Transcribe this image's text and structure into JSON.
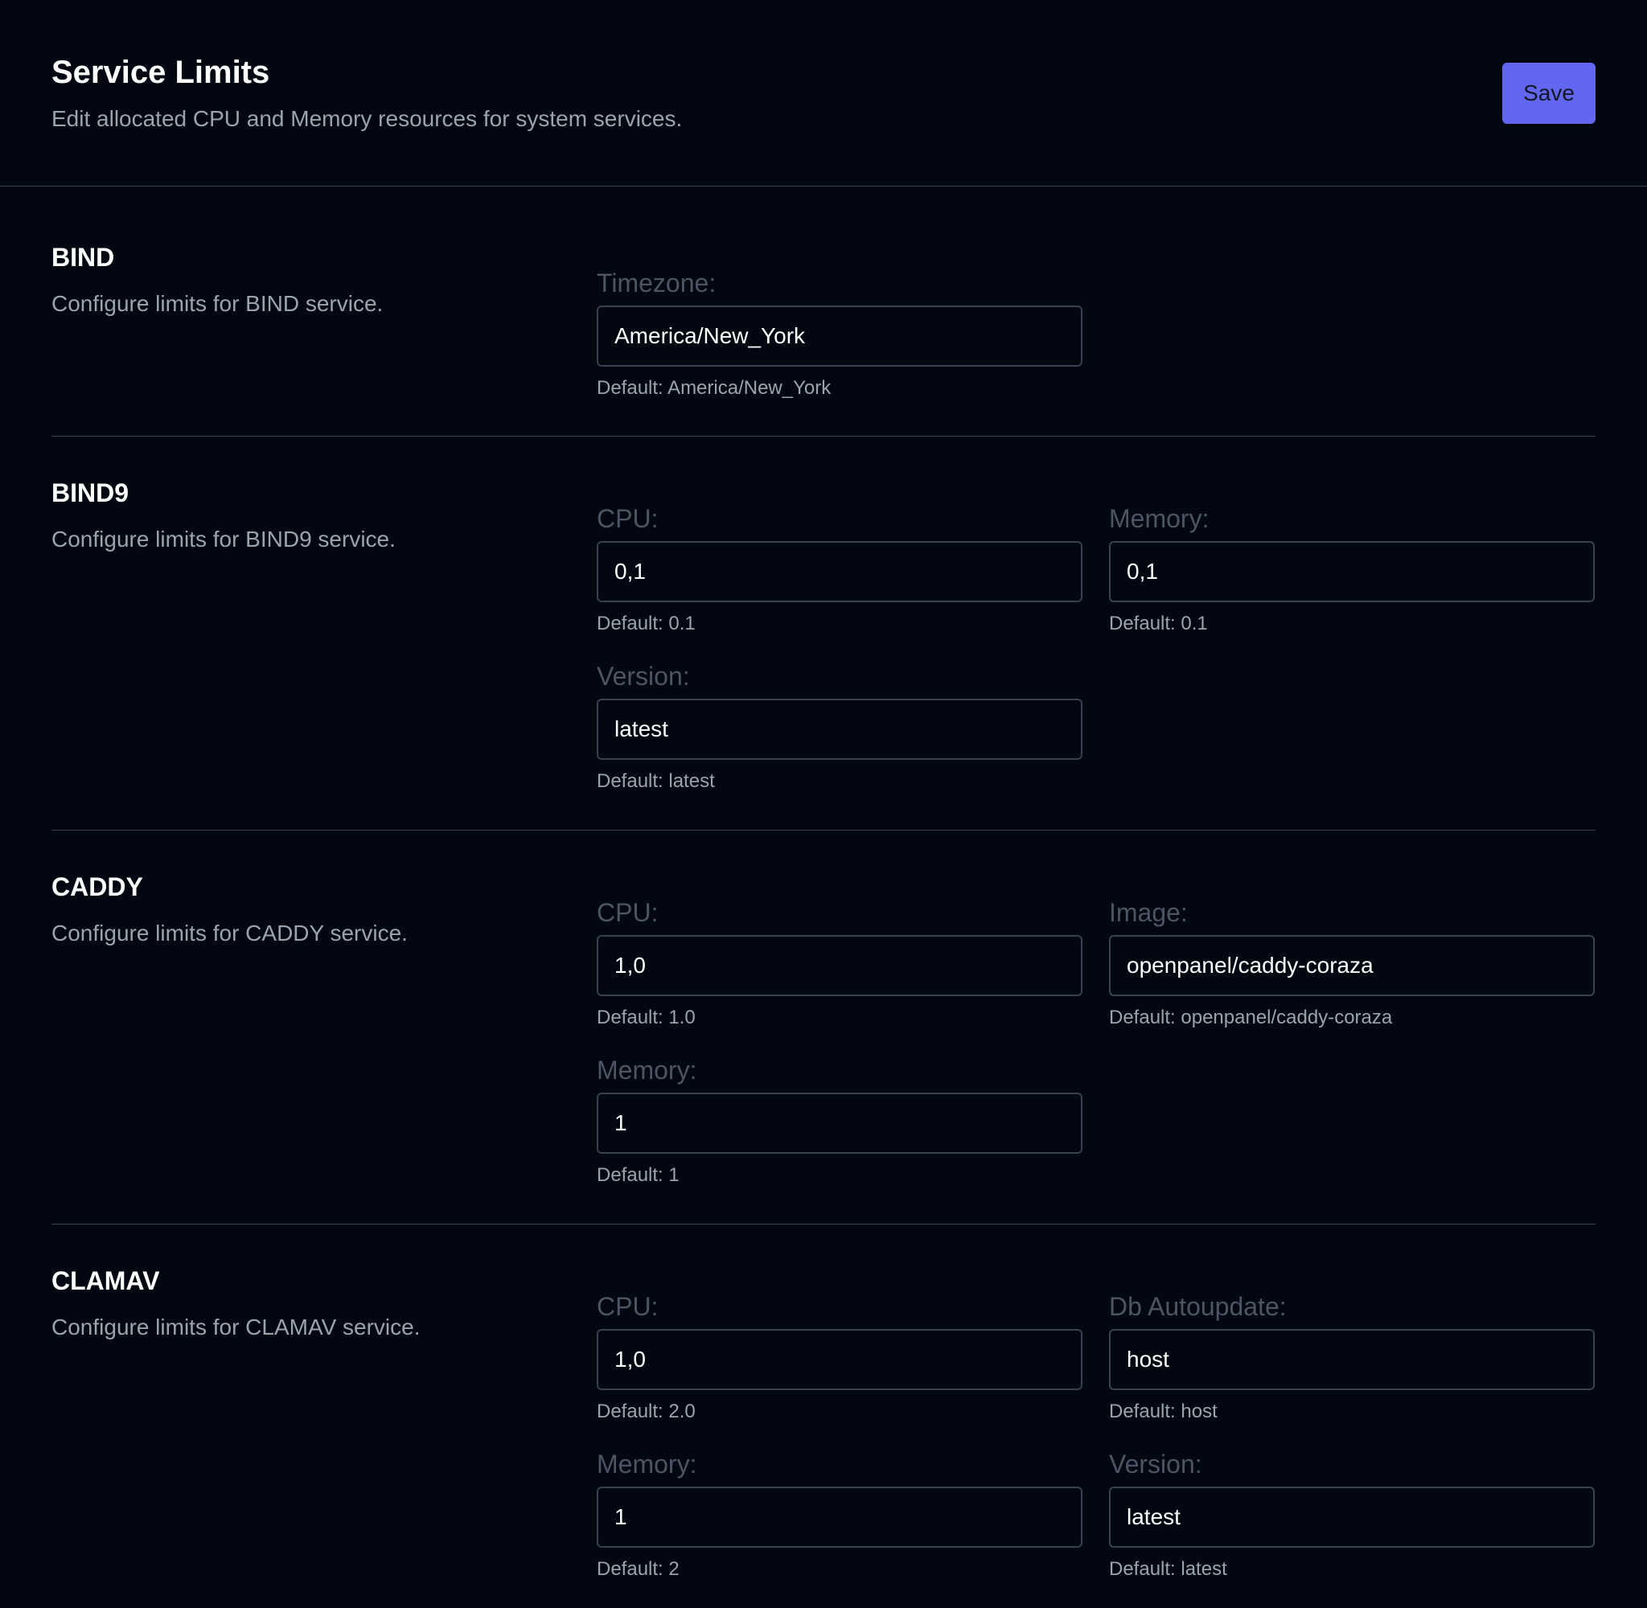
{
  "header": {
    "title": "Service Limits",
    "subtitle": "Edit allocated CPU and Memory resources for system services.",
    "save_label": "Save"
  },
  "sections": [
    {
      "title": "BIND",
      "description": "Configure limits for BIND service.",
      "fields": [
        {
          "label": "Timezone:",
          "value": "America/New_York",
          "hint": "Default: America/New_York"
        }
      ]
    },
    {
      "title": "BIND9",
      "description": "Configure limits for BIND9 service.",
      "fields": [
        {
          "label": "CPU:",
          "value": "0,1",
          "hint": "Default: 0.1"
        },
        {
          "label": "Memory:",
          "value": "0,1",
          "hint": "Default: 0.1"
        },
        {
          "label": "Version:",
          "value": "latest",
          "hint": "Default: latest"
        }
      ]
    },
    {
      "title": "CADDY",
      "description": "Configure limits for CADDY service.",
      "fields": [
        {
          "label": "CPU:",
          "value": "1,0",
          "hint": "Default: 1.0"
        },
        {
          "label": "Image:",
          "value": "openpanel/caddy-coraza",
          "hint": "Default: openpanel/caddy-coraza"
        },
        {
          "label": "Memory:",
          "value": "1",
          "hint": "Default: 1"
        }
      ]
    },
    {
      "title": "CLAMAV",
      "description": "Configure limits for CLAMAV service.",
      "fields": [
        {
          "label": "CPU:",
          "value": "1,0",
          "hint": "Default: 2.0"
        },
        {
          "label": "Db Autoupdate:",
          "value": "host",
          "hint": "Default: host"
        },
        {
          "label": "Memory:",
          "value": "1",
          "hint": "Default: 2"
        },
        {
          "label": "Version:",
          "value": "latest",
          "hint": "Default: latest"
        }
      ]
    }
  ]
}
